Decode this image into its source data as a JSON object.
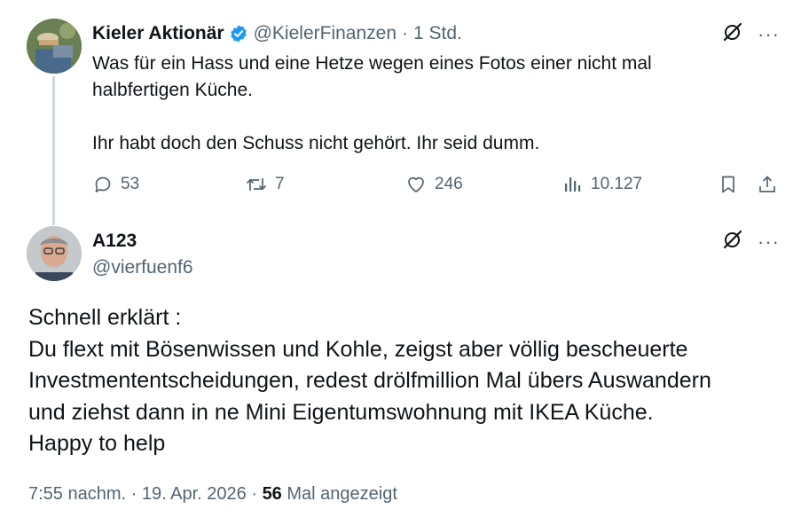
{
  "parent_tweet": {
    "author_name": "Kieler Aktionär",
    "handle": "@KielerFinanzen",
    "separator": "·",
    "time": "1 Std.",
    "text": "Was für ein Hass und eine Hetze wegen eines Fotos einer nicht mal\nhalbfertigen Küche.\n\nIhr habt doch den Schuss nicht gehört. Ihr seid dumm.",
    "actions": {
      "replies": "53",
      "reposts": "7",
      "likes": "246",
      "views": "10.127"
    },
    "icons": [
      "verified-badge-icon",
      "grok-icon",
      "more-icon",
      "reply-icon",
      "repost-icon",
      "like-icon",
      "views-icon",
      "bookmark-icon",
      "share-icon"
    ]
  },
  "reply_tweet": {
    "author_name": "A123",
    "handle": "@vierfuenf6",
    "text": "Schnell erklärt :\nDu flext mit Bösenwissen und Kohle, zeigst aber völlig bescheuerte\nInvestmententscheidungen, redest drölfmillion Mal übers Auswandern\nund ziehst dann in ne Mini Eigentumswohnung mit IKEA Küche.\nHappy to help",
    "timestamp": "7:55 nachm.",
    "date": "19. Apr. 2026",
    "separator": "·",
    "view_count": "56",
    "view_label": "Mal angezeigt"
  },
  "colors": {
    "text": "#0f1419",
    "secondary": "#536471",
    "verified": "#1d9bf0",
    "thread_line": "#cfd9de"
  }
}
